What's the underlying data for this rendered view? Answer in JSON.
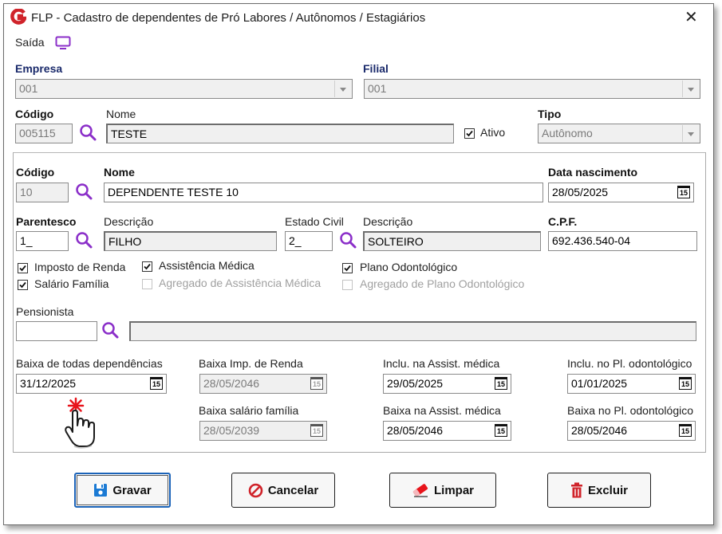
{
  "window": {
    "title": "FLP - Cadastro de dependentes de Pró Labores / Autônomos / Estagiários",
    "close_symbol": "✕"
  },
  "menu": {
    "saida": "Saída"
  },
  "empresa": {
    "label": "Empresa",
    "value": "001"
  },
  "filial": {
    "label": "Filial",
    "value": "001"
  },
  "codigo": {
    "label": "Código",
    "value": "005115"
  },
  "nome": {
    "label": "Nome",
    "value": "TESTE"
  },
  "ativo": {
    "label": "Ativo",
    "checked": true
  },
  "tipo": {
    "label": "Tipo",
    "value": "Autônomo"
  },
  "dep": {
    "codigo_label": "Código",
    "codigo_value": "10",
    "nome_label": "Nome",
    "nome_value": "DEPENDENTE TESTE 10",
    "nasc_label": "Data nascimento",
    "nasc_value": "28/05/2025",
    "parentesco_label": "Parentesco",
    "parentesco_value": "1_",
    "desc1_label": "Descrição",
    "desc1_value": "FILHO",
    "estado_label": "Estado Civil",
    "estado_value": "2_",
    "desc2_label": "Descrição",
    "desc2_value": "SOLTEIRO",
    "cpf_label": "C.P.F.",
    "cpf_value": "692.436.540-04"
  },
  "checks": {
    "imposto": "Imposto de Renda",
    "assist": "Assistência Médica",
    "plano": "Plano Odontológico",
    "salario": "Salário Família",
    "agregado_assist": "Agregado de Assistência Médica",
    "agregado_plano": "Agregado de Plano Odontológico"
  },
  "pensionista": {
    "label": "Pensionista",
    "code": "",
    "desc": ""
  },
  "dates": {
    "baixa_todas_label": "Baixa de todas dependências",
    "baixa_todas_value": "31/12/2025",
    "baixa_imp_label": "Baixa Imp. de Renda",
    "baixa_imp_value": "28/05/2046",
    "inclu_assist_label": "Inclu. na Assist. médica",
    "inclu_assist_value": "29/05/2025",
    "inclu_plano_label": "Inclu. no Pl. odontológico",
    "inclu_plano_value": "01/01/2025",
    "baixa_sal_label": "Baixa salário família",
    "baixa_sal_value": "28/05/2039",
    "baixa_assist_label": "Baixa na Assist. médica",
    "baixa_assist_value": "28/05/2046",
    "baixa_plano_label": "Baixa no Pl. odontológico",
    "baixa_plano_value": "28/05/2046",
    "cal_glyph": "15"
  },
  "buttons": {
    "gravar": "Gravar",
    "cancelar": "Cancelar",
    "limpar": "Limpar",
    "excluir": "Excluir"
  },
  "colors": {
    "brand_red": "#d0232a",
    "lens_purple": "#8b2fc9",
    "label_navy": "#1a2a6b",
    "save_blue": "#1b63b8"
  },
  "icons": [
    "logo-icon",
    "monitor-icon",
    "search-icon",
    "calendar-icon",
    "save-icon",
    "cancel-icon",
    "eraser-icon",
    "trash-icon",
    "hand-cursor-icon"
  ]
}
